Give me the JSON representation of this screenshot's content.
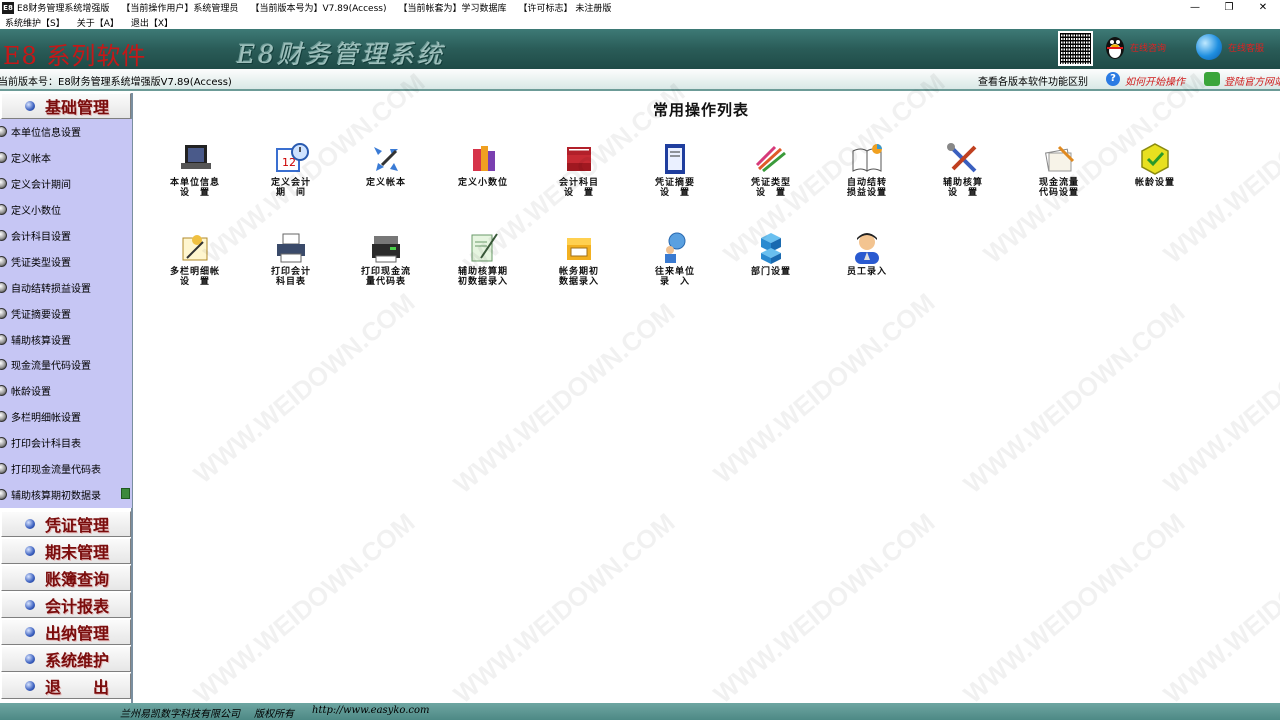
{
  "titlebar": {
    "title": "E8财务管理系统增强版",
    "current_user": "【当前操作用户】系统管理员",
    "current_version": "【当前版本号为】V7.89(Access)",
    "current_book": "【当前帐套为】学习数据库",
    "license": "【许可标志】 未注册版",
    "app_icon": "E8",
    "minimize": "—",
    "maximize": "❐",
    "close": "✕"
  },
  "menubar": [
    "系统维护【S】",
    "关于【A】",
    "退出【X】"
  ],
  "banner": {
    "brand": "E8 系列软件",
    "system_title": "E8财务管理系统",
    "qq_label": "在线咨询",
    "globe_label": "在线客服"
  },
  "infobar": {
    "version": "当前版本号：E8财务管理系统增强版V7.89(Access)",
    "compare": "查看各版本软件功能区别",
    "how_to_start": "如何开始操作",
    "login_site": "登陆官方网站"
  },
  "sidebar": {
    "top_category": "基础管理",
    "items": [
      "本单位信息设置",
      "定义帐本",
      "定义会计期间",
      "定义小数位",
      "会计科目设置",
      "凭证类型设置",
      "自动结转损益设置",
      "凭证摘要设置",
      "辅助核算设置",
      "现金流量代码设置",
      "帐龄设置",
      "多栏明细帐设置",
      "打印会计科目表",
      "打印现金流量代码表",
      "辅助核算期初数据录"
    ],
    "bottom_categories": [
      "凭证管理",
      "期末管理",
      "账簿查询",
      "会计报表",
      "出纳管理",
      "系统维护",
      "退　　出"
    ]
  },
  "main": {
    "title": "常用操作列表",
    "tiles": [
      {
        "label": "本单位信息\n设　置",
        "icon": "monitor-icon"
      },
      {
        "label": "定义会计\n期　间",
        "icon": "calendar-clock-icon"
      },
      {
        "label": "定义帐本",
        "icon": "arrows-pen-icon"
      },
      {
        "label": "定义小数位",
        "icon": "books-icon"
      },
      {
        "label": "会计科目\n设　置",
        "icon": "red-ledger-icon"
      },
      {
        "label": "凭证摘要\n设　置",
        "icon": "notepad-icon"
      },
      {
        "label": "凭证类型\n设　置",
        "icon": "pencils-icon"
      },
      {
        "label": "自动结转\n损益设置",
        "icon": "chart-book-icon"
      },
      {
        "label": "辅助核算\n设　置",
        "icon": "tools-icon"
      },
      {
        "label": "现金流量\n代码设置",
        "icon": "papers-icon"
      },
      {
        "label": "帐龄设置",
        "icon": "hexagon-check-icon"
      },
      {
        "label": "多栏明细帐\n设　置",
        "icon": "writing-paper-icon"
      },
      {
        "label": "打印会计\n科目表",
        "icon": "printer-icon"
      },
      {
        "label": "打印现金流\n量代码表",
        "icon": "printer2-icon"
      },
      {
        "label": "辅助核算期\n初数据录入",
        "icon": "document-pen-icon"
      },
      {
        "label": "帐务期初\n数据录入",
        "icon": "yellow-box-icon"
      },
      {
        "label": "往来单位\n录　入",
        "icon": "globe-person-icon"
      },
      {
        "label": "部门设置",
        "icon": "cubes-icon"
      },
      {
        "label": "员工录入",
        "icon": "person-icon"
      }
    ]
  },
  "watermark": "WWW.WEIDOWN.COM",
  "footer": {
    "company": "兰州易凯数字科技有限公司",
    "rights": "版权所有",
    "url": "http://www.easyko.com"
  }
}
